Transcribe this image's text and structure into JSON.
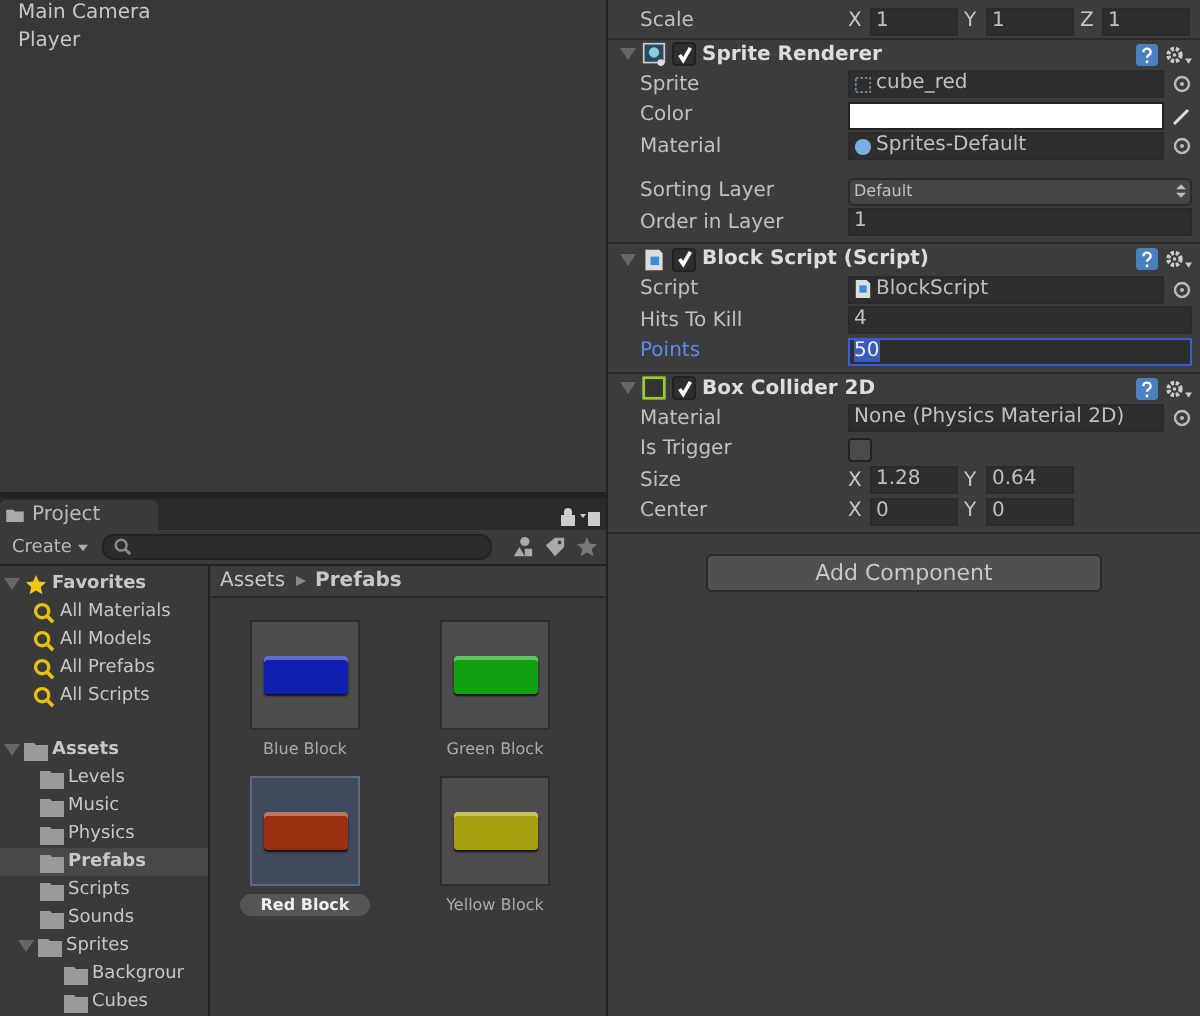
{
  "hierarchy": {
    "items": [
      {
        "label": "Main Camera",
        "selected": false
      },
      {
        "label": "Player",
        "selected": false
      }
    ]
  },
  "inspector": {
    "scale": {
      "label": "Scale",
      "axes": [
        {
          "axis": "X",
          "value": "1"
        },
        {
          "axis": "Y",
          "value": "1"
        },
        {
          "axis": "Z",
          "value": "1"
        }
      ]
    },
    "components": [
      {
        "title": "Sprite Renderer",
        "kind": "sprite",
        "enabled": true,
        "expanded": true,
        "fields": [
          {
            "label": "Sprite",
            "kind": "sprite",
            "value": "cube_red",
            "focused": false
          },
          {
            "label": "Color",
            "kind": "color",
            "color": "#ffffff",
            "focused": false
          },
          {
            "label": "Material",
            "kind": "material",
            "value": "Sprites-Default",
            "focused": false
          },
          {
            "label": "Sorting Layer",
            "kind": "dropdown",
            "value": "Default",
            "focused": false
          },
          {
            "label": "Order in Layer",
            "kind": "text",
            "value": "1",
            "focused": false
          }
        ]
      },
      {
        "title": "Block Script (Script)",
        "kind": "script",
        "enabled": true,
        "expanded": true,
        "fields": [
          {
            "label": "Script",
            "kind": "script",
            "value": "BlockScript",
            "focused": false
          },
          {
            "label": "Hits To Kill",
            "kind": "text",
            "value": "4",
            "focused": false
          },
          {
            "label": "Points",
            "kind": "text",
            "value": "50",
            "focused": true
          }
        ]
      },
      {
        "title": "Box Collider 2D",
        "kind": "collider",
        "enabled": true,
        "expanded": true,
        "fields": [
          {
            "label": "Material",
            "kind": "object",
            "value": "None (Physics Material 2D)",
            "focused": false
          },
          {
            "label": "Is Trigger",
            "kind": "checkbox",
            "checked": false,
            "focused": false
          },
          {
            "label": "Size",
            "kind": "vector",
            "axes": [
              {
                "axis": "X",
                "value": "1.28"
              },
              {
                "axis": "Y",
                "value": "0.64"
              }
            ],
            "focused": false
          },
          {
            "label": "Center",
            "kind": "vector",
            "axes": [
              {
                "axis": "X",
                "value": "0"
              },
              {
                "axis": "Y",
                "value": "0"
              }
            ],
            "focused": false
          }
        ]
      }
    ],
    "add_component_button": "Add Component"
  },
  "project": {
    "tab": "Project",
    "create_button": "Create",
    "favorites": {
      "label": "Favorites",
      "expanded": true,
      "items": [
        "All Materials",
        "All Models",
        "All Prefabs",
        "All Scripts"
      ]
    },
    "assets": {
      "label": "Assets",
      "expanded": true,
      "children": [
        {
          "label": "Levels",
          "selected": false
        },
        {
          "label": "Music",
          "selected": false
        },
        {
          "label": "Physics",
          "selected": false
        },
        {
          "label": "Prefabs",
          "selected": true
        },
        {
          "label": "Scripts",
          "selected": false
        },
        {
          "label": "Sounds",
          "selected": false
        },
        {
          "label": "Sprites",
          "selected": false,
          "expanded": true,
          "children": [
            {
              "label": "Backgrour",
              "selected": false
            },
            {
              "label": "Cubes",
              "selected": false
            }
          ]
        }
      ]
    },
    "breadcrumb": [
      "Assets",
      "Prefabs"
    ],
    "tiles": [
      {
        "label": "Blue Block",
        "color": "#0f1fb0",
        "selected": false
      },
      {
        "label": "Green Block",
        "color": "#10a010",
        "selected": false
      },
      {
        "label": "Red Block",
        "color": "#9a3010",
        "selected": true
      },
      {
        "label": "Yellow Block",
        "color": "#a8a010",
        "selected": false
      }
    ]
  }
}
